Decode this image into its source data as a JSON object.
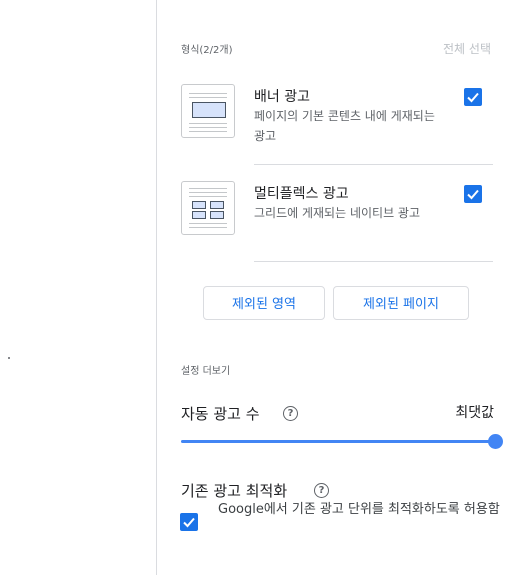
{
  "formats": {
    "header": "형식(2/2개)",
    "select_all": "전체 선택",
    "items": [
      {
        "title": "배너 광고",
        "description": "페이지의 기본 콘텐츠 내에 게재되는 광고",
        "checked": true,
        "icon": "banner-ad-icon"
      },
      {
        "title": "멀티플렉스 광고",
        "description": "그리드에 게재되는 네이티브 광고",
        "checked": true,
        "icon": "multiplex-ad-icon"
      }
    ]
  },
  "buttons": {
    "excluded_areas": "제외된 영역",
    "excluded_pages": "제외된 페이지"
  },
  "more_settings": {
    "header": "설정 더보기",
    "auto_ad_count": {
      "label": "자동 광고 수",
      "value_label": "최댓값",
      "slider_value": 1.0
    },
    "existing_ad_optimization": {
      "label": "기존 광고 최적화",
      "checkbox_label": "Google에서 기존 광고 단위를 최적화하도록 허용함",
      "checked": true
    }
  },
  "colors": {
    "accent": "#1a73e8",
    "slider": "#4285f4"
  }
}
